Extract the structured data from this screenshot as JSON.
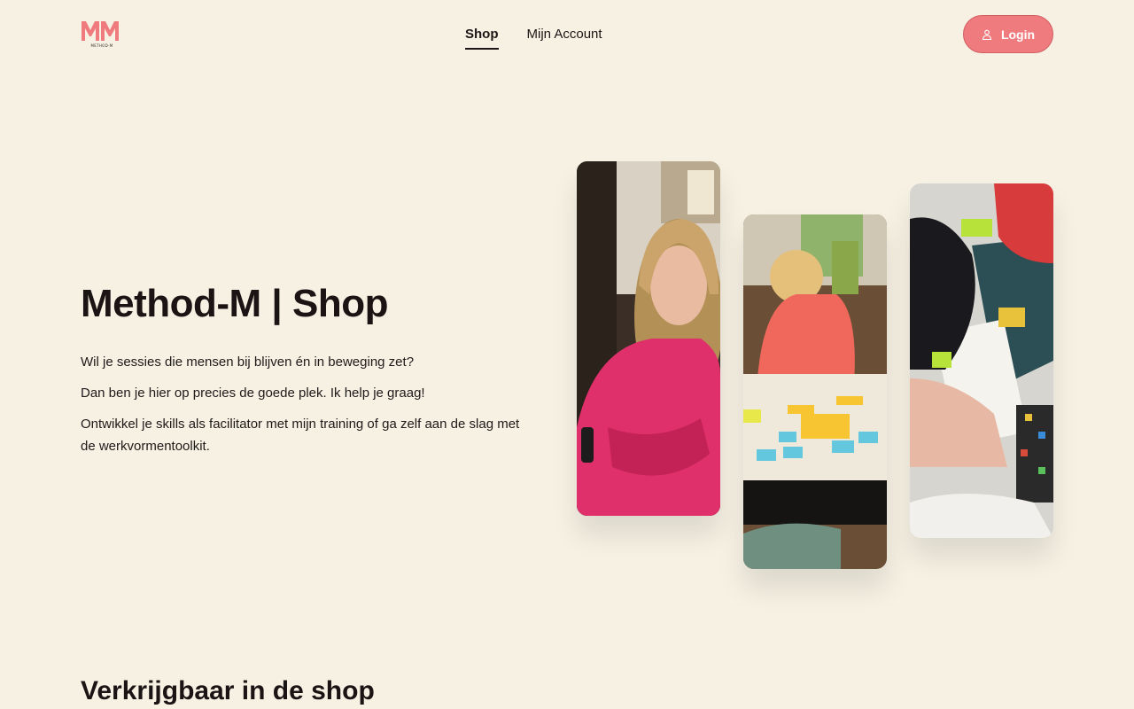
{
  "brand": {
    "logo_text": "METHOD-M",
    "accent": "#f07b7e"
  },
  "nav": {
    "items": [
      {
        "label": "Shop",
        "active": true
      },
      {
        "label": "Mijn Account",
        "active": false
      }
    ],
    "login_label": "Login"
  },
  "hero": {
    "title": "Method-M | Shop",
    "paragraphs": [
      "Wil je sessies die mensen bij blijven én in beweging zet?",
      "Dan ben je hier op precies de goede plek. Ik help je graag!",
      "Ontwikkel je skills als facilitator met mijn training of ga zelf aan de slag met de werkvormentoolkit."
    ]
  },
  "section": {
    "title": "Verkrijgbaar in de shop"
  }
}
